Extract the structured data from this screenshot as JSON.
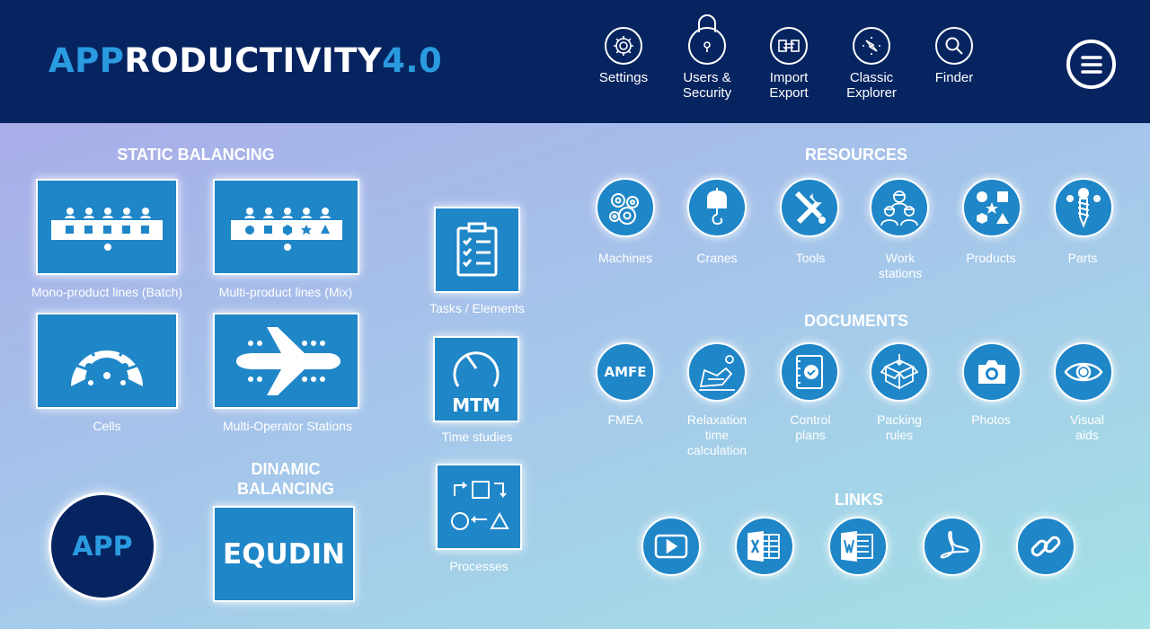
{
  "header": {
    "logo": {
      "part1": "APP",
      "part2": "RODUCTIVITY",
      "part3": "4.0"
    },
    "nav": [
      {
        "label": "Settings",
        "icon": "gear-icon"
      },
      {
        "label": "Users &\nSecurity",
        "icon": "lock-icon"
      },
      {
        "label": "Import\nExport",
        "icon": "import-export-icon"
      },
      {
        "label": "Classic\nExplorer",
        "icon": "compass-icon"
      },
      {
        "label": "Finder",
        "icon": "search-icon"
      }
    ],
    "menu_icon": "hamburger-menu-icon"
  },
  "static_balancing": {
    "title": "STATIC BALANCING",
    "tiles": [
      {
        "label": "Mono-product lines (Batch)",
        "icon": "mono-line-icon"
      },
      {
        "label": "Multi-product lines (Mix)",
        "icon": "multi-line-icon"
      },
      {
        "label": "Cells",
        "icon": "cell-icon"
      },
      {
        "label": "Multi-Operator Stations",
        "icon": "airplane-icon"
      }
    ]
  },
  "dynamic_balancing": {
    "title_line1": "DINAMIC",
    "title_line2": "BALANCING",
    "tile_text": "EQUDIN"
  },
  "app_button": "APP",
  "middle": [
    {
      "label": "Tasks / Elements",
      "icon": "checklist-icon"
    },
    {
      "label": "Time studies",
      "icon": "stopwatch-icon",
      "text": "MTM"
    },
    {
      "label": "Processes",
      "icon": "process-flow-icon"
    }
  ],
  "resources": {
    "title": "RESOURCES",
    "items": [
      {
        "label": "Machines",
        "icon": "gears-icon"
      },
      {
        "label": "Cranes",
        "icon": "crane-hook-icon"
      },
      {
        "label": "Tools",
        "icon": "tools-icon"
      },
      {
        "label": "Work\nstations",
        "icon": "workers-icon"
      },
      {
        "label": "Products",
        "icon": "shapes-icon"
      },
      {
        "label": "Parts",
        "icon": "screw-icon"
      }
    ]
  },
  "documents": {
    "title": "DOCUMENTS",
    "items": [
      {
        "label": "FMEA",
        "icon": "amfe-icon",
        "text": "AMFE"
      },
      {
        "label": "Relaxation\ntime\ncalculation",
        "icon": "armchair-icon"
      },
      {
        "label": "Control\nplans",
        "icon": "control-plan-icon"
      },
      {
        "label": "Packing\nrules",
        "icon": "box-icon"
      },
      {
        "label": "Photos",
        "icon": "camera-icon"
      },
      {
        "label": "Visual\naids",
        "icon": "eye-icon"
      }
    ]
  },
  "links": {
    "title": "LINKS",
    "items": [
      {
        "icon": "video-play-icon"
      },
      {
        "icon": "excel-icon"
      },
      {
        "icon": "word-icon"
      },
      {
        "icon": "pdf-icon"
      },
      {
        "icon": "chain-link-icon"
      }
    ]
  },
  "colors": {
    "navy": "#062460",
    "accent": "#2a9be0",
    "tile": "#1f86c8"
  }
}
